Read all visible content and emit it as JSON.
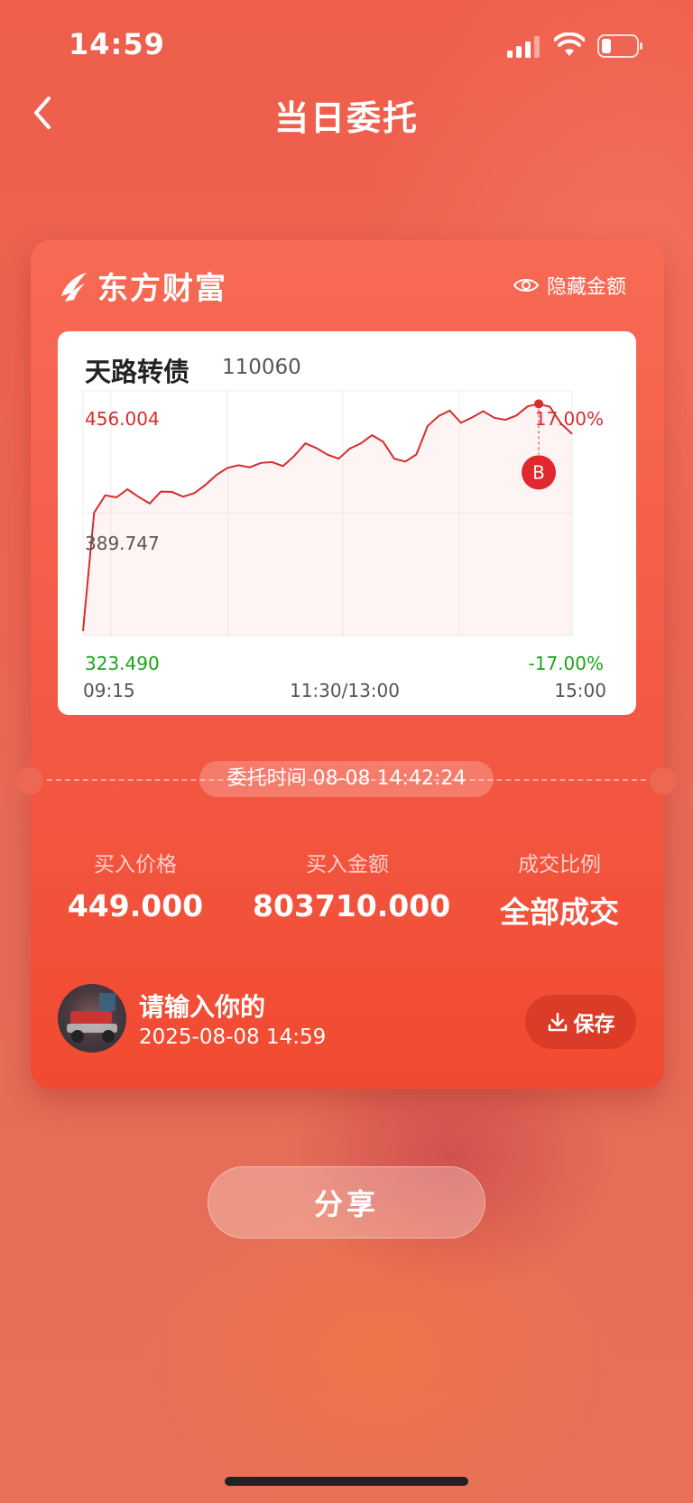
{
  "status_bar": {
    "time": "14:59"
  },
  "nav": {
    "title": "当日委托"
  },
  "card": {
    "brand": "东方财富",
    "hide_amount_label": "隐藏金额",
    "stock": {
      "name": "天路转债",
      "code": "110060"
    },
    "order_time_label": "委托时间 08-08 14:42:24",
    "stats": [
      {
        "label": "买入价格",
        "value": "449.000"
      },
      {
        "label": "买入金额",
        "value": "803710.000"
      },
      {
        "label": "成交比例",
        "value": "全部成交"
      }
    ],
    "user": {
      "name": "请输入你的",
      "time": "2025-08-08 14:59"
    },
    "save_label": "保存"
  },
  "share_label": "分享",
  "colors": {
    "accent": "#f25640",
    "up": "#e0282e",
    "down": "#1ba31b"
  },
  "chart_data": {
    "type": "line",
    "y_labels": {
      "max": "456.004",
      "mid": "389.747",
      "min": "323.490"
    },
    "pct_labels": {
      "max": "17.00%",
      "min": "-17.00%"
    },
    "x_labels": [
      "09:15",
      "11:30/13:00",
      "15:00"
    ],
    "ylim": [
      323.49,
      456.004
    ],
    "reference": 389.747,
    "buy_marker": {
      "label": "B",
      "value": 449.0
    },
    "series": [
      {
        "values": [
          326,
          390,
          400,
          398,
          403,
          398,
          395,
          402,
          401,
          399,
          400,
          405,
          411,
          414,
          416,
          414,
          417,
          418,
          415,
          421,
          427,
          425,
          422,
          419,
          425,
          427,
          432,
          429,
          419,
          418,
          421,
          437,
          443,
          445,
          439,
          441,
          445,
          442,
          440,
          443,
          447,
          449,
          448,
          438,
          433
        ]
      }
    ],
    "grid": true
  }
}
